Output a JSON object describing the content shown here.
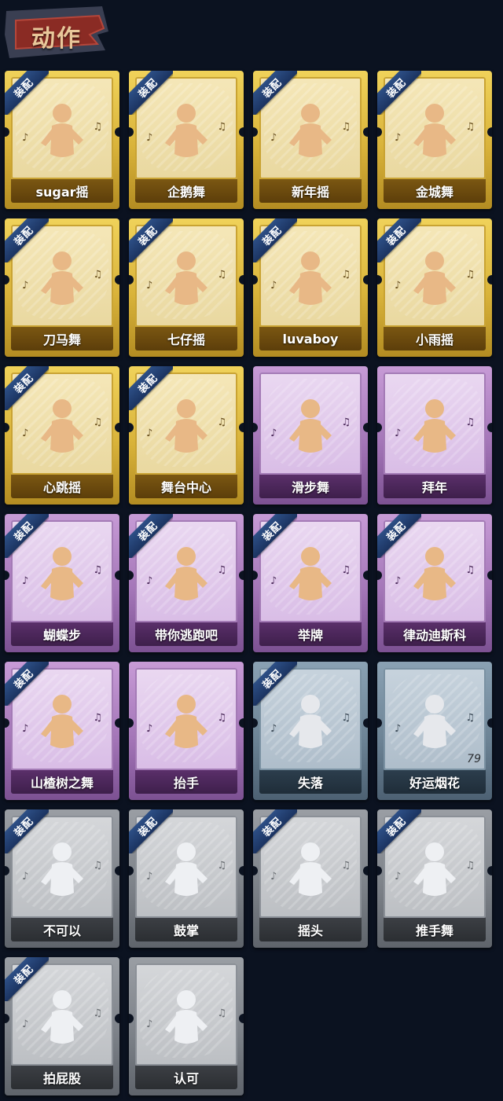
{
  "header": {
    "title": "动作"
  },
  "badge_label": "装配",
  "items": [
    {
      "name": "sugar摇",
      "rarity": "gold",
      "equipped": true,
      "icon": "dance-figure-icon"
    },
    {
      "name": "企鹅舞",
      "rarity": "gold",
      "equipped": true,
      "icon": "dance-figure-icon"
    },
    {
      "name": "新年摇",
      "rarity": "gold",
      "equipped": true,
      "icon": "dance-figure-icon"
    },
    {
      "name": "金城舞",
      "rarity": "gold",
      "equipped": true,
      "icon": "dance-figure-icon"
    },
    {
      "name": "刀马舞",
      "rarity": "gold",
      "equipped": true,
      "icon": "dance-figure-icon"
    },
    {
      "name": "七仔摇",
      "rarity": "gold",
      "equipped": true,
      "icon": "dance-figure-icon"
    },
    {
      "name": "luvaboy",
      "rarity": "gold",
      "equipped": true,
      "icon": "dance-figure-icon"
    },
    {
      "name": "小雨摇",
      "rarity": "gold",
      "equipped": true,
      "icon": "dance-figure-icon"
    },
    {
      "name": "心跳摇",
      "rarity": "gold",
      "equipped": true,
      "icon": "dance-figure-icon"
    },
    {
      "name": "舞台中心",
      "rarity": "gold",
      "equipped": true,
      "icon": "dance-figure-icon"
    },
    {
      "name": "滑步舞",
      "rarity": "purple",
      "equipped": false,
      "icon": "dance-figure-icon"
    },
    {
      "name": "拜年",
      "rarity": "purple",
      "equipped": false,
      "icon": "bow-figure-icon"
    },
    {
      "name": "蝴蝶步",
      "rarity": "purple",
      "equipped": true,
      "icon": "dance-figure-icon"
    },
    {
      "name": "带你逃跑吧",
      "rarity": "purple",
      "equipped": true,
      "icon": "dance-figure-icon"
    },
    {
      "name": "举牌",
      "rarity": "purple",
      "equipped": true,
      "icon": "sign-figure-icon"
    },
    {
      "name": "律动迪斯科",
      "rarity": "purple",
      "equipped": true,
      "icon": "dance-figure-icon"
    },
    {
      "name": "山楂树之舞",
      "rarity": "purple",
      "equipped": true,
      "icon": "dance-figure-icon"
    },
    {
      "name": "抬手",
      "rarity": "purple",
      "equipped": false,
      "icon": "raise-hand-icon"
    },
    {
      "name": "失落",
      "rarity": "blue",
      "equipped": true,
      "icon": "crawl-figure-icon"
    },
    {
      "name": "好运烟花",
      "rarity": "blue",
      "equipped": false,
      "icon": "firework-icon",
      "count": "79"
    },
    {
      "name": "不可以",
      "rarity": "grey",
      "equipped": true,
      "icon": "finger-wag-icon"
    },
    {
      "name": "鼓掌",
      "rarity": "grey",
      "equipped": true,
      "icon": "clap-hands-icon"
    },
    {
      "name": "摇头",
      "rarity": "grey",
      "equipped": true,
      "icon": "shake-head-icon"
    },
    {
      "name": "推手舞",
      "rarity": "grey",
      "equipped": true,
      "icon": "push-hands-icon"
    },
    {
      "name": "拍屁股",
      "rarity": "grey",
      "equipped": true,
      "icon": "pat-figure-icon"
    },
    {
      "name": "认可",
      "rarity": "grey",
      "equipped": false,
      "icon": "thumbs-up-icon"
    }
  ]
}
